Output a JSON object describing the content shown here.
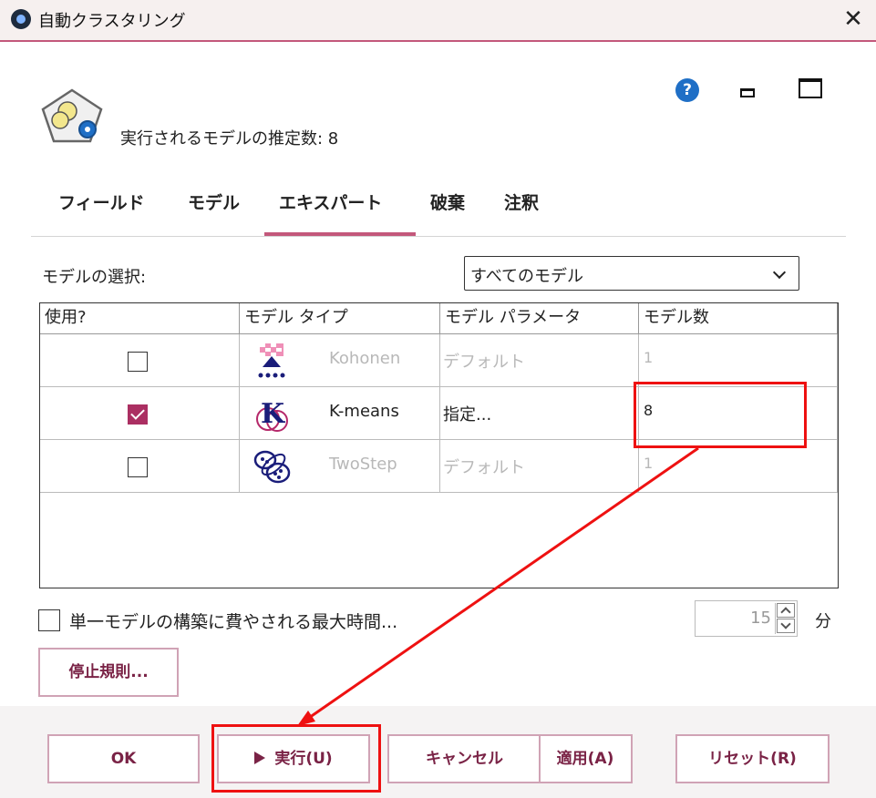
{
  "window": {
    "title": "自動クラスタリング",
    "close_label": "✕"
  },
  "header": {
    "estimate_text": "実行されるモデルの推定数: 8",
    "help_label": "?"
  },
  "tabs": [
    {
      "label": "フィールド"
    },
    {
      "label": "モデル"
    },
    {
      "label": "エキスパート"
    },
    {
      "label": "破棄"
    },
    {
      "label": "注釈"
    }
  ],
  "model_selection": {
    "label": "モデルの選択:",
    "value": "すべてのモデル"
  },
  "table": {
    "headers": [
      "使用?",
      "モデル タイプ",
      "モデル パラメータ",
      "モデル数"
    ],
    "rows": [
      {
        "checked": false,
        "type": "Kohonen",
        "params": "デフォルト",
        "count": "1"
      },
      {
        "checked": true,
        "type": "K-means",
        "params": "指定...",
        "count": "8"
      },
      {
        "checked": false,
        "type": "TwoStep",
        "params": "デフォルト",
        "count": "1"
      }
    ]
  },
  "max_time": {
    "label": "単一モデルの構築に費やされる最大時間...",
    "value": "15",
    "unit": "分"
  },
  "stop_rules_label": "停止規則...",
  "footer": {
    "ok": "OK",
    "run": "実行(U)",
    "cancel": "キャンセル",
    "apply": "適用(A)",
    "reset": "リセット(R)"
  },
  "colors": {
    "accent": "#c3587b",
    "checkbox": "#ab2f62",
    "annotation": "#ee1111",
    "help": "#1f6fc6"
  }
}
